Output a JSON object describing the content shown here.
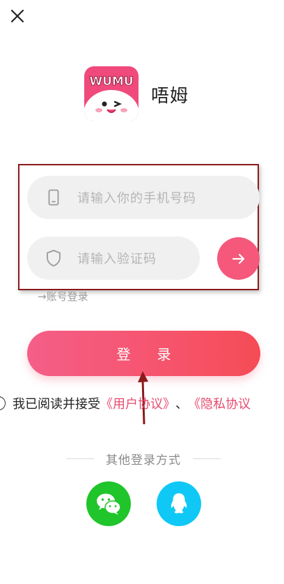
{
  "app": {
    "name": "唔姆",
    "logo_text": "WUMU"
  },
  "form": {
    "phone_placeholder": "请输入你的手机号码",
    "code_placeholder": "请输入验证码",
    "account_login_link": "→账号登录"
  },
  "login_button": {
    "label": "登录"
  },
  "agreement": {
    "prefix": "我已阅读并接受",
    "user_agreement": "《用户协议》",
    "separator": "、",
    "privacy_policy": "《隐私协议"
  },
  "other_login": {
    "label": "其他登录方式"
  },
  "icons": {
    "close": "close-icon",
    "phone": "phone-icon",
    "shield": "shield-icon",
    "arrow": "arrow-right-icon",
    "wechat": "wechat-icon",
    "qq": "qq-icon"
  },
  "colors": {
    "accent": "#f5587a",
    "link": "#e84a6f",
    "wechat": "#1fc52a",
    "qq": "#0fc8f6",
    "annotation": "#8b1a1a"
  }
}
